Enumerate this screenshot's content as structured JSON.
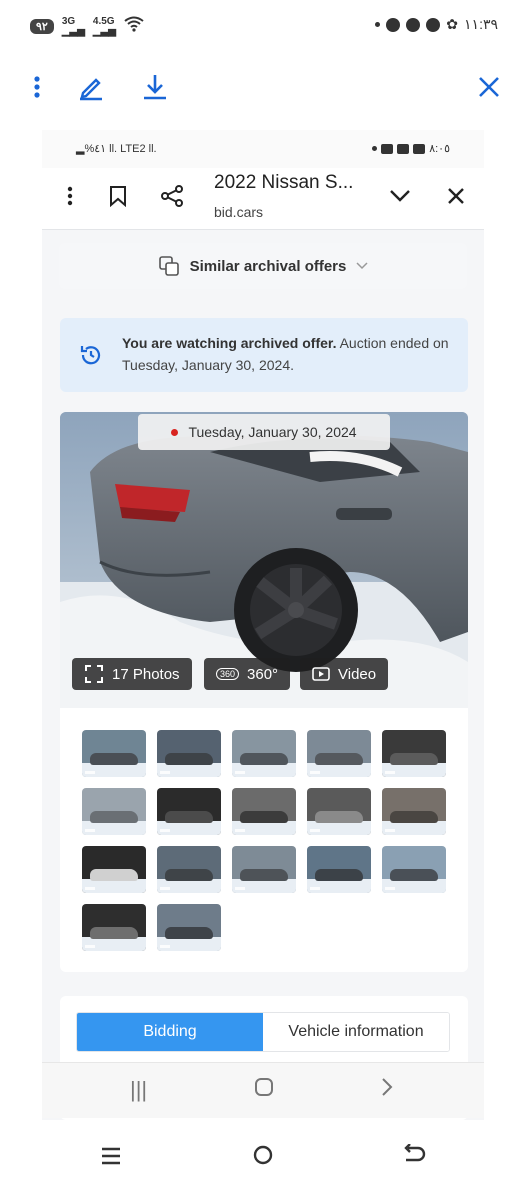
{
  "outer_status": {
    "battery": "٩٢",
    "net1": "3G",
    "net2": "4.5G",
    "time": "١١:٣٩"
  },
  "toolbar": {
    "icons": [
      "more-vert-icon",
      "edit-icon",
      "download-icon",
      "close-icon"
    ]
  },
  "inner_status": {
    "left": "▂%٤١ ll. LTE2 ll.",
    "time": "٨:٠٥"
  },
  "browser": {
    "title": "2022 Nissan S...",
    "domain": "bid.cars"
  },
  "similar": {
    "label": "Similar archival offers"
  },
  "archived": {
    "bold": "You are watching archived offer.",
    "rest": " Auction ended on Tuesday, January 30, 2024."
  },
  "photo": {
    "date": "Tuesday, January 30, 2024",
    "photos_label": "17 Photos",
    "badge_360": "360",
    "label_360": "360°",
    "video_label": "Video"
  },
  "thumbnails": [
    {
      "bg": "#6f8594",
      "car": "#4a4f55"
    },
    {
      "bg": "#556270",
      "car": "#3e4348"
    },
    {
      "bg": "#8795a0",
      "car": "#50565c"
    },
    {
      "bg": "#7d8a96",
      "car": "#55595e"
    },
    {
      "bg": "#3a3a3a",
      "car": "#5b5b5b"
    },
    {
      "bg": "#9aa4ad",
      "car": "#6a6f74"
    },
    {
      "bg": "#2b2b2b",
      "car": "#4b4b4b"
    },
    {
      "bg": "#6b6b6b",
      "car": "#3c3c3c"
    },
    {
      "bg": "#5a5a5a",
      "car": "#8a8a8a"
    },
    {
      "bg": "#77706a",
      "car": "#4a4642"
    },
    {
      "bg": "#2a2a2a",
      "car": "#d0d0d0"
    },
    {
      "bg": "#5d6b78",
      "car": "#3f4448"
    },
    {
      "bg": "#7e8b96",
      "car": "#4e5358"
    },
    {
      "bg": "#5f7588",
      "car": "#3c4248"
    },
    {
      "bg": "#8aa0b3",
      "car": "#4a5057"
    },
    {
      "bg": "#2e2e2e",
      "car": "#6e6e6e"
    },
    {
      "bg": "#6e7c8a",
      "car": "#3e4349"
    }
  ],
  "tabs": [
    "Bidding",
    "Vehicle information"
  ],
  "colors": {
    "accent": "#1a66d6",
    "tab_active": "#3596f0"
  }
}
